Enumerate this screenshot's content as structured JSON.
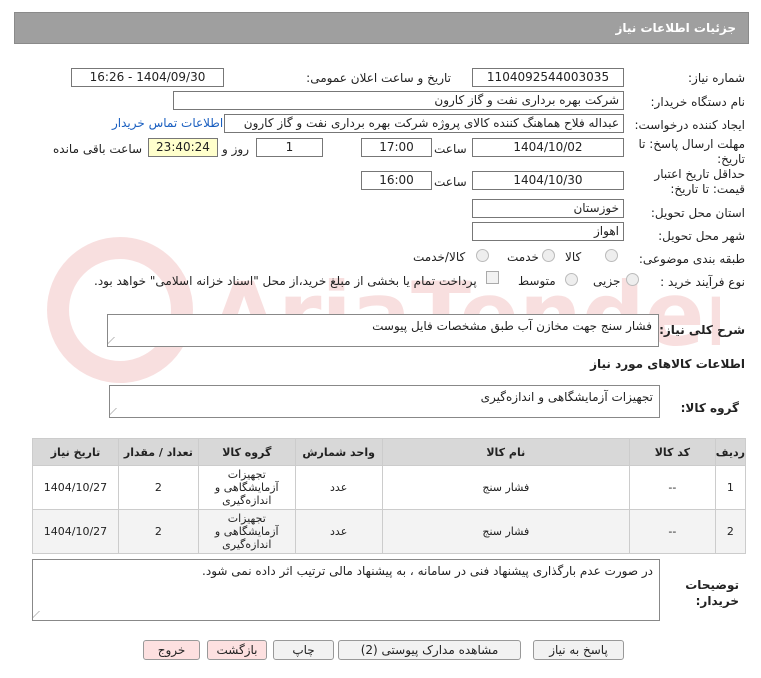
{
  "header": {
    "title": "جزئیات اطلاعات نیاز"
  },
  "labels": {
    "need_number": "شماره نیاز:",
    "announce_datetime": "تاریخ و ساعت اعلان عمومی:",
    "buyer_org": "نام دستگاه خریدار:",
    "creator": "ایجاد کننده درخواست:",
    "deadline": "مهلت ارسال پاسخ: تا تاریخ:",
    "deadline_line1": "مهلت ارسال پاسخ: تا",
    "deadline_line2": "تاریخ:",
    "time": "ساعت",
    "day_and": "روز و",
    "remaining": "ساعت باقی مانده",
    "min_valid": "حداقل تاریخ اعتبار",
    "min_valid2": "قیمت: تا تاریخ:",
    "province": "استان محل تحویل:",
    "city": "شهر محل تحویل:",
    "category": "طبقه بندی موضوعی:",
    "process": "نوع فرآیند خرید :",
    "description": "شرح کلی نیاز:",
    "goods_info": "اطلاعات کالاهای مورد نیاز",
    "goods_group": "گروه کالا:",
    "buyer_notes1": "توضیحات",
    "buyer_notes2": "خریدار:"
  },
  "values": {
    "need_number": "1104092544003035",
    "announce_datetime": "1404/09/30 - 16:26",
    "buyer_org": "شرکت بهره برداری نفت و گاز کارون",
    "creator": "عبداله فلاح هماهنگ کننده کالای پروژه شرکت بهره برداری نفت و گاز کارون",
    "contact_link": "اطلاعات تماس خریدار",
    "deadline_date": "1404/10/02",
    "deadline_time": "17:00",
    "days": "1",
    "remaining_time": "23:40:24",
    "valid_date": "1404/10/30",
    "valid_time": "16:00",
    "province": "خوزستان",
    "city": "اهواز",
    "description": "فشار سنج جهت مخازن آب طبق مشخصات فایل پیوست",
    "goods_group": "تجهیزات آزمایشگاهی و اندازه‌گیری",
    "buyer_notes": "در صورت عدم بارگذاری پیشنهاد فنی در سامانه ، به پیشنهاد مالی ترتیب اثر داده نمی شود."
  },
  "category_options": [
    "کالا",
    "خدمت",
    "کالا/خدمت"
  ],
  "process_options": [
    "جزیی",
    "متوسط"
  ],
  "process_note": "پرداخت تمام یا بخشی از مبلغ خرید،از محل \"اسناد خزانه اسلامی\" خواهد بود.",
  "table": {
    "headers": [
      "ردیف",
      "کد کالا",
      "نام کالا",
      "واحد شمارش",
      "گروه کالا",
      "تعداد / مقدار",
      "تاریخ نیاز"
    ],
    "rows": [
      [
        "1",
        "--",
        "فشار سنج",
        "عدد",
        "تجهیزات آزمایشگاهی و اندازه‌گیری",
        "2",
        "1404/10/27"
      ],
      [
        "2",
        "--",
        "فشار سنج",
        "عدد",
        "تجهیزات آزمایشگاهی و اندازه‌گیری",
        "2",
        "1404/10/27"
      ]
    ]
  },
  "buttons": {
    "reply": "پاسخ به نیاز",
    "attachments": "مشاهده مدارک پیوستی (2)",
    "print": "چاپ",
    "back": "بازگشت",
    "exit": "خروج"
  },
  "watermark": "AriaTender.net"
}
